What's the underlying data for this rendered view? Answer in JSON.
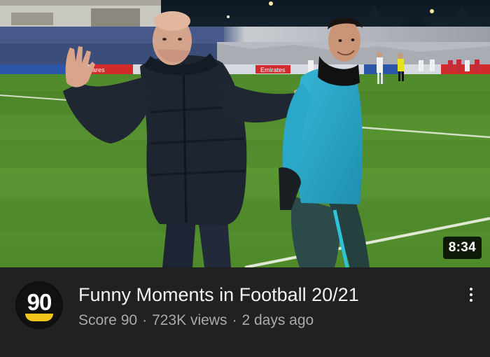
{
  "video": {
    "duration": "8:34",
    "title": "Funny Moments in Football 20/21",
    "channel": "Score 90",
    "views": "723K views",
    "age": "2 days ago",
    "separator": "·",
    "ad_boards": [
      "ares",
      "Emirates"
    ]
  },
  "channel_avatar": {
    "text": "90",
    "accent_color": "#f0c419"
  },
  "theme": {
    "background": "#212121",
    "title_color": "#f1f1f1",
    "meta_color": "#aaaaaa"
  },
  "icons": {
    "more_menu": "vertical-ellipsis-icon"
  }
}
